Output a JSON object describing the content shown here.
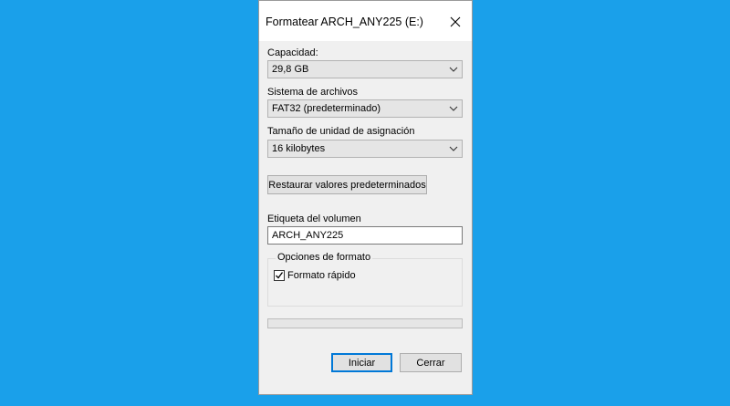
{
  "window": {
    "title": "Formatear ARCH_ANY225 (E:)"
  },
  "capacity": {
    "label": "Capacidad:",
    "value": "29,8 GB"
  },
  "filesystem": {
    "label": "Sistema de archivos",
    "value": "FAT32 (predeterminado)"
  },
  "allocation": {
    "label": "Tamaño de unidad de asignación",
    "value": "16 kilobytes"
  },
  "restore_button": "Restaurar valores predeterminados",
  "volume_label": {
    "label": "Etiqueta del volumen",
    "value": "ARCH_ANY225"
  },
  "format_options": {
    "legend": "Opciones de formato",
    "quick_format_label": "Formato rápido",
    "quick_format_checked": true
  },
  "progress": {
    "fraction": 0
  },
  "buttons": {
    "start": "Iniciar",
    "close": "Cerrar"
  },
  "colors": {
    "desktop": "#1aa0ea",
    "dialog_bg": "#f0f0f0",
    "primary_border": "#0078d7"
  },
  "icons": {
    "close": "close-icon",
    "dropdown": "chevron-down-icon",
    "checkmark": "checkmark-icon"
  }
}
